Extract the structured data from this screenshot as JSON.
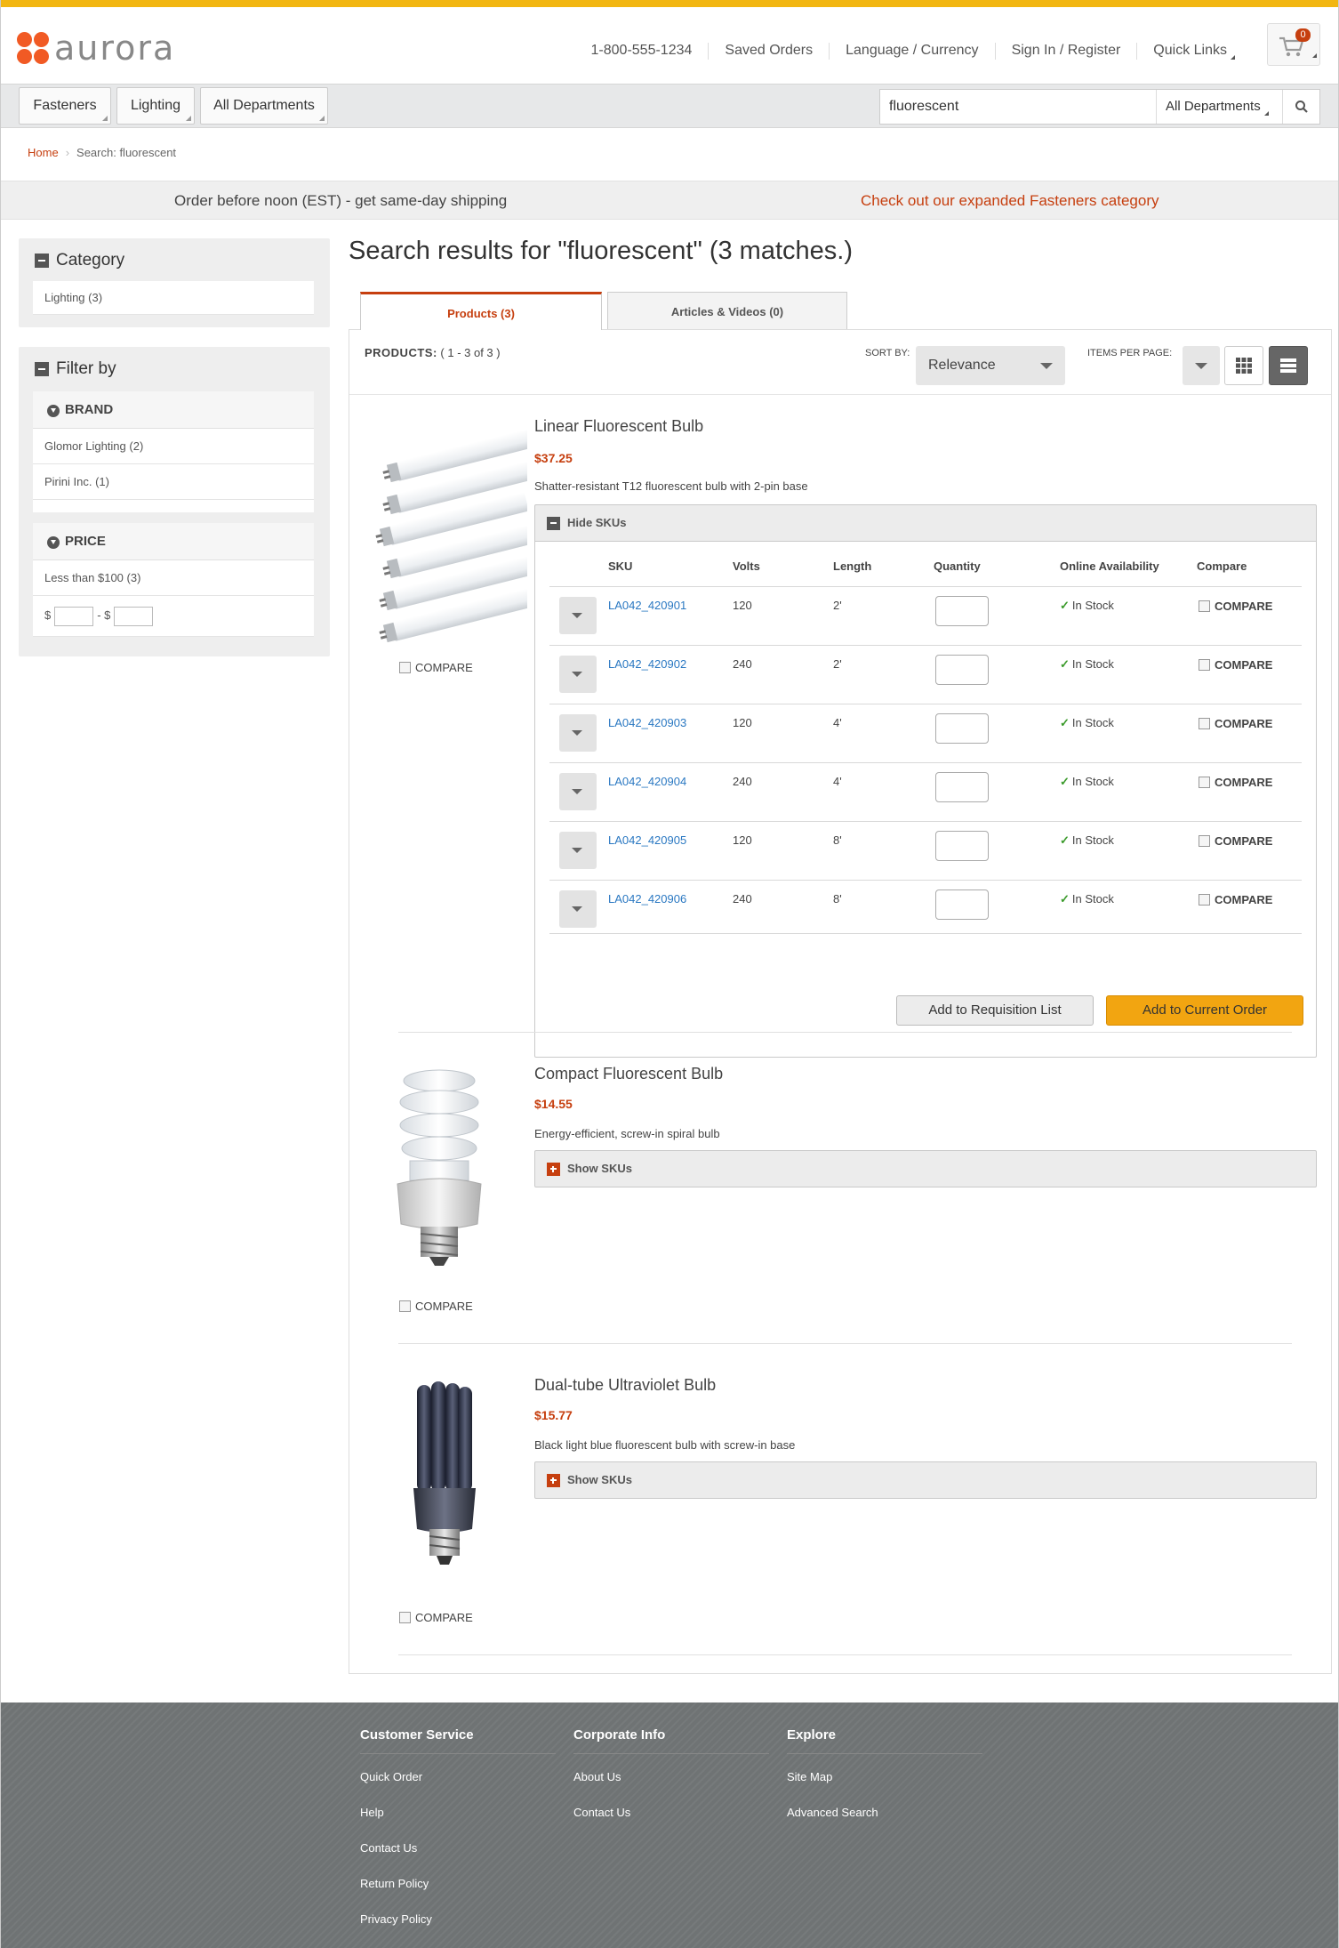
{
  "brand": {
    "name": "aurora",
    "accent": "#c63f0f",
    "topbar": "#f2b611",
    "cta": "#f2a511"
  },
  "header": {
    "links": [
      "1-800-555-1234",
      "Saved Orders",
      "Language / Currency",
      "Sign In / Register",
      "Quick Links"
    ],
    "cart_count": "0",
    "cart_icon": "cart-icon"
  },
  "nav": {
    "departments": [
      "Fasteners",
      "Lighting",
      "All Departments"
    ],
    "search_value": "fluorescent",
    "search_scope": "All Departments",
    "search_icon": "search-icon"
  },
  "breadcrumb": {
    "home": "Home",
    "current": "Search: fluorescent"
  },
  "promo": {
    "left": "Order before noon (EST) - get same-day shipping",
    "right": "Check out our expanded Fasteners category"
  },
  "sidebar": {
    "category_title": "Category",
    "category_items": [
      "Lighting (3)"
    ],
    "filter_title": "Filter by",
    "brand_title": "BRAND",
    "brand_items": [
      "Glomor Lighting (2)",
      "Pirini Inc. (1)"
    ],
    "price_title": "PRICE",
    "price_items": [
      "Less than $100 (3)"
    ],
    "price_from_label": "$",
    "price_to_label": "- $"
  },
  "results": {
    "title": "Search results for \"fluorescent\" (3 matches.)",
    "tabs": [
      "Products (3)",
      "Articles & Videos (0)"
    ],
    "products_label": "PRODUCTS:",
    "products_range": "( 1 - 3 of 3 )",
    "sort_label": "SORT BY:",
    "sort_value": "Relevance",
    "ipp_label": "ITEMS PER PAGE:"
  },
  "products": [
    {
      "name": "Linear Fluorescent Bulb",
      "price": "$37.25",
      "desc": "Shatter-resistant T12 fluorescent bulb with 2-pin base",
      "sku_toggle": "Hide SKUs",
      "compare": "COMPARE"
    },
    {
      "name": "Compact Fluorescent Bulb",
      "price": "$14.55",
      "desc": "Energy-efficient, screw-in spiral bulb",
      "sku_toggle": "Show SKUs",
      "compare": "COMPARE"
    },
    {
      "name": "Dual-tube Ultraviolet Bulb",
      "price": "$15.77",
      "desc": "Black light blue fluorescent bulb with screw-in base",
      "sku_toggle": "Show SKUs",
      "compare": "COMPARE"
    }
  ],
  "sku_table": {
    "headers": [
      "SKU",
      "Volts",
      "Length",
      "Quantity",
      "Online Availability",
      "Compare"
    ],
    "rows": [
      {
        "sku": "LA042_420901",
        "volts": "120",
        "length": "2'",
        "availability": "In Stock",
        "compare": "COMPARE"
      },
      {
        "sku": "LA042_420902",
        "volts": "240",
        "length": "2'",
        "availability": "In Stock",
        "compare": "COMPARE"
      },
      {
        "sku": "LA042_420903",
        "volts": "120",
        "length": "4'",
        "availability": "In Stock",
        "compare": "COMPARE"
      },
      {
        "sku": "LA042_420904",
        "volts": "240",
        "length": "4'",
        "availability": "In Stock",
        "compare": "COMPARE"
      },
      {
        "sku": "LA042_420905",
        "volts": "120",
        "length": "8'",
        "availability": "In Stock",
        "compare": "COMPARE"
      },
      {
        "sku": "LA042_420906",
        "volts": "240",
        "length": "8'",
        "availability": "In Stock",
        "compare": "COMPARE"
      }
    ],
    "add_requisition": "Add to Requisition List",
    "add_order": "Add to Current Order"
  },
  "footer": {
    "columns": [
      {
        "title": "Customer Service",
        "links": [
          "Quick Order",
          "Help",
          "Contact Us",
          "Return Policy",
          "Privacy Policy"
        ]
      },
      {
        "title": "Corporate Info",
        "links": [
          "About Us",
          "Contact Us"
        ]
      },
      {
        "title": "Explore",
        "links": [
          "Site Map",
          "Advanced Search"
        ]
      }
    ]
  }
}
